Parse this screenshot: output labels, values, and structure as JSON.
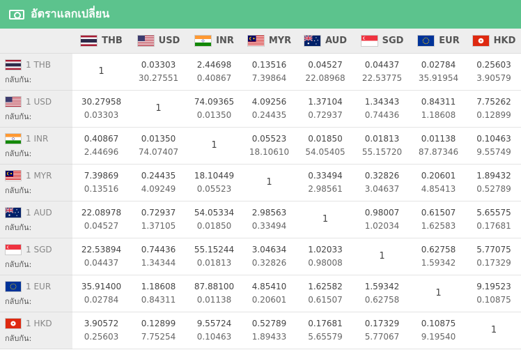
{
  "app": {
    "title": "อัตราแลกเปลี่ยน",
    "icon": "money-icon"
  },
  "currencies": [
    "THB",
    "USD",
    "INR",
    "MYR",
    "AUD",
    "SGD",
    "EUR",
    "HKD"
  ],
  "rows": [
    {
      "label": "1 THB",
      "sub": "กลับกัน:",
      "cells": [
        {
          "self": "1"
        },
        {
          "v": "0.03303",
          "r": "30.27551"
        },
        {
          "v": "2.44698",
          "r": "0.40867"
        },
        {
          "v": "0.13516",
          "r": "7.39864"
        },
        {
          "v": "0.04527",
          "r": "22.08968"
        },
        {
          "v": "0.04437",
          "r": "22.53775"
        },
        {
          "v": "0.02784",
          "r": "35.91954"
        },
        {
          "v": "0.25603",
          "r": "3.90579"
        }
      ]
    },
    {
      "label": "1 USD",
      "sub": "กลับกัน:",
      "cells": [
        {
          "v": "30.27958",
          "r": "0.03303"
        },
        {
          "self": "1"
        },
        {
          "v": "74.09365",
          "r": "0.01350"
        },
        {
          "v": "4.09256",
          "r": "0.24435"
        },
        {
          "v": "1.37104",
          "r": "0.72937"
        },
        {
          "v": "1.34343",
          "r": "0.74436"
        },
        {
          "v": "0.84311",
          "r": "1.18608"
        },
        {
          "v": "7.75262",
          "r": "0.12899"
        }
      ]
    },
    {
      "label": "1 INR",
      "sub": "กลับกัน:",
      "cells": [
        {
          "v": "0.40867",
          "r": "2.44696"
        },
        {
          "v": "0.01350",
          "r": "74.07407"
        },
        {
          "self": "1"
        },
        {
          "v": "0.05523",
          "r": "18.10610"
        },
        {
          "v": "0.01850",
          "r": "54.05405"
        },
        {
          "v": "0.01813",
          "r": "55.15720"
        },
        {
          "v": "0.01138",
          "r": "87.87346"
        },
        {
          "v": "0.10463",
          "r": "9.55749"
        }
      ]
    },
    {
      "label": "1 MYR",
      "sub": "กลับกัน:",
      "cells": [
        {
          "v": "7.39869",
          "r": "0.13516"
        },
        {
          "v": "0.24435",
          "r": "4.09249"
        },
        {
          "v": "18.10449",
          "r": "0.05523"
        },
        {
          "self": "1"
        },
        {
          "v": "0.33494",
          "r": "2.98561"
        },
        {
          "v": "0.32826",
          "r": "3.04637"
        },
        {
          "v": "0.20601",
          "r": "4.85413"
        },
        {
          "v": "1.89432",
          "r": "0.52789"
        }
      ]
    },
    {
      "label": "1 AUD",
      "sub": "กลับกัน:",
      "cells": [
        {
          "v": "22.08978",
          "r": "0.04527"
        },
        {
          "v": "0.72937",
          "r": "1.37105"
        },
        {
          "v": "54.05334",
          "r": "0.01850"
        },
        {
          "v": "2.98563",
          "r": "0.33494"
        },
        {
          "self": "1"
        },
        {
          "v": "0.98007",
          "r": "1.02034"
        },
        {
          "v": "0.61507",
          "r": "1.62583"
        },
        {
          "v": "5.65575",
          "r": "0.17681"
        }
      ]
    },
    {
      "label": "1 SGD",
      "sub": "กลับกัน:",
      "cells": [
        {
          "v": "22.53894",
          "r": "0.04437"
        },
        {
          "v": "0.74436",
          "r": "1.34344"
        },
        {
          "v": "55.15244",
          "r": "0.01813"
        },
        {
          "v": "3.04634",
          "r": "0.32826"
        },
        {
          "v": "1.02033",
          "r": "0.98008"
        },
        {
          "self": "1"
        },
        {
          "v": "0.62758",
          "r": "1.59342"
        },
        {
          "v": "5.77075",
          "r": "0.17329"
        }
      ]
    },
    {
      "label": "1 EUR",
      "sub": "กลับกัน:",
      "cells": [
        {
          "v": "35.91400",
          "r": "0.02784"
        },
        {
          "v": "1.18608",
          "r": "0.84311"
        },
        {
          "v": "87.88100",
          "r": "0.01138"
        },
        {
          "v": "4.85410",
          "r": "0.20601"
        },
        {
          "v": "1.62582",
          "r": "0.61507"
        },
        {
          "v": "1.59342",
          "r": "0.62758"
        },
        {
          "self": "1"
        },
        {
          "v": "9.19523",
          "r": "0.10875"
        }
      ]
    },
    {
      "label": "1 HKD",
      "sub": "กลับกัน:",
      "cells": [
        {
          "v": "3.90572",
          "r": "0.25603"
        },
        {
          "v": "0.12899",
          "r": "7.75254"
        },
        {
          "v": "9.55724",
          "r": "0.10463"
        },
        {
          "v": "0.52789",
          "r": "1.89433"
        },
        {
          "v": "0.17681",
          "r": "5.65579"
        },
        {
          "v": "0.17329",
          "r": "5.77067"
        },
        {
          "v": "0.10875",
          "r": "9.19540"
        },
        {
          "self": "1"
        }
      ]
    }
  ],
  "colors": {
    "header_bar": "#5cc38d",
    "table_header": "#eeeeee",
    "row_label_bg": "#eeeeee",
    "border": "#dddddd"
  }
}
